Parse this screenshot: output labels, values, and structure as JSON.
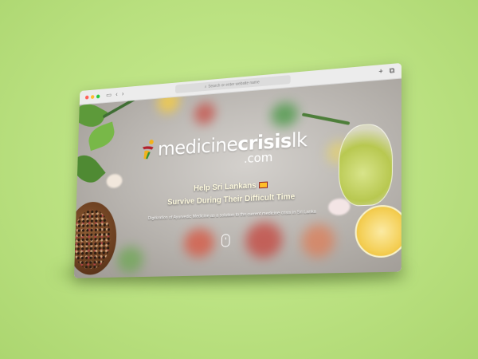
{
  "browser": {
    "address_placeholder": "Search or enter website name",
    "new_tab_icon": "plus-icon",
    "tabs_icon": "tabs-icon"
  },
  "hero": {
    "logo_light": "medicine",
    "logo_bold": "crisis",
    "logo_suffix": "lk",
    "logo_domain": ".com",
    "headline_line1": "Help Sri Lankans",
    "headline_line2": "Survive During Their Difficult Time",
    "subline": "Digitization of Ayurvedic Medicine as a solution to the current medicine crisis in Sri Lanka",
    "scroll_icon": "mouse-scroll-icon"
  },
  "colors": {
    "background": "#bde283",
    "headline": "#fffbe0",
    "logo_mark_yellow": "#f2b21c",
    "logo_mark_red": "#b3202c",
    "logo_mark_green": "#2f8f3a"
  }
}
